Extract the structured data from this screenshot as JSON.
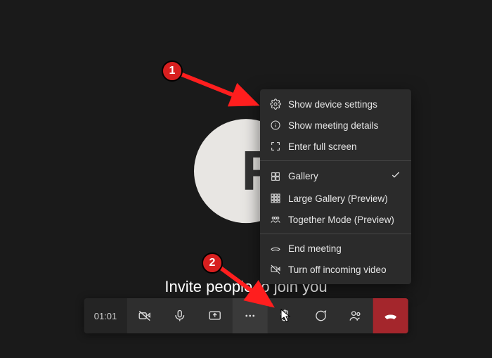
{
  "avatar": {
    "initial": "P"
  },
  "invite_text": "Invite people to join you",
  "toolbar": {
    "timer": "01:01"
  },
  "menu": {
    "device_settings": "Show device settings",
    "meeting_details": "Show meeting details",
    "fullscreen": "Enter full screen",
    "gallery": "Gallery",
    "large_gallery": "Large Gallery (Preview)",
    "together": "Together Mode (Preview)",
    "end_meeting": "End meeting",
    "turn_off_incoming": "Turn off incoming video"
  },
  "annotations": {
    "badge1": "1",
    "badge2": "2"
  }
}
